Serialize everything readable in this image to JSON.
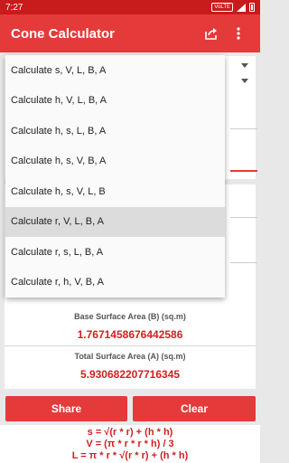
{
  "status_bar": {
    "time": "7:27",
    "network": "VoLTE"
  },
  "app_bar": {
    "title": "Cone Calculator"
  },
  "results": [
    {
      "label": "Base Surface Area (B) (sq.m)",
      "value": "1.7671458676442586"
    },
    {
      "label": "Total Surface Area (A) (sq.m)",
      "value": "5.930682207716345"
    }
  ],
  "buttons": {
    "share": "Share",
    "clear": "Clear"
  },
  "formulas": [
    "s = √(r * r) + (h * h)",
    "V = (π * r * r * h) / 3",
    "L = π * r * √(r * r) + (h * h)"
  ],
  "dropdown": {
    "options": [
      "Calculate s, V, L, B, A",
      "Calculate h, V, L, B, A",
      "Calculate h, s, L, B, A",
      "Calculate h, s, V, B, A",
      "Calculate h, s, V, L, B",
      "Calculate r, V, L, B, A",
      "Calculate r, s, L, B, A",
      "Calculate r, h, V, B, A"
    ],
    "selected": "Calculate r, V, L, B, A"
  },
  "colors": {
    "primary": "#e53a3a",
    "status_bar": "#c81b1b",
    "value_text": "#d11f1f"
  }
}
